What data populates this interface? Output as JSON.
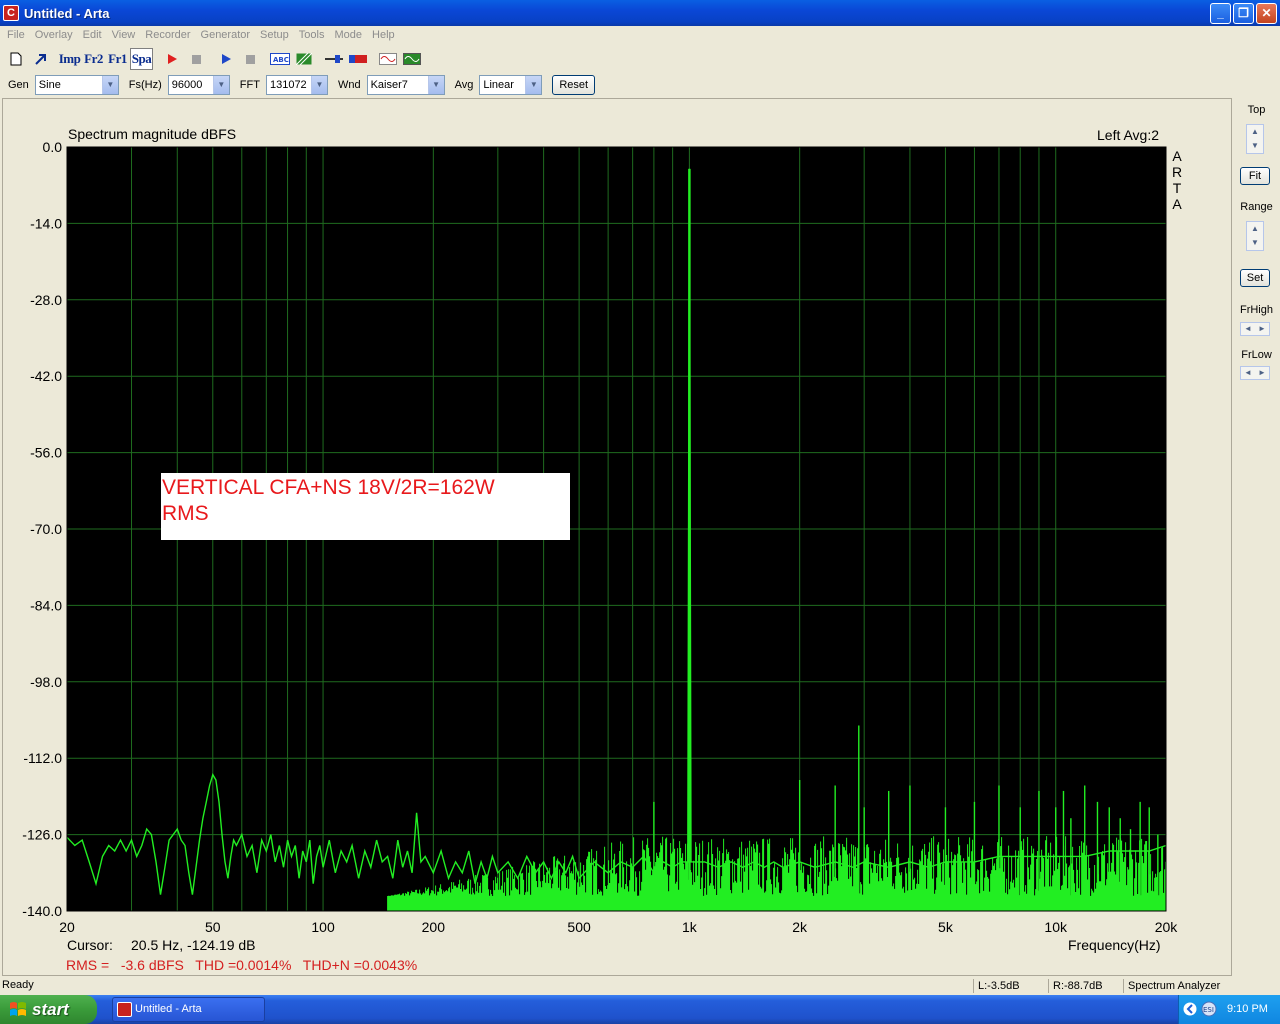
{
  "window": {
    "title": "Untitled - Arta",
    "app_icon_letter": "C",
    "min": "0",
    "max": "1",
    "close": "r"
  },
  "menu": [
    "File",
    "Overlay",
    "Edit",
    "View",
    "Recorder",
    "Generator",
    "Setup",
    "Tools",
    "Mode",
    "Help"
  ],
  "toolbar": {
    "imp": "Imp",
    "fr2": "Fr2",
    "fr1": "Fr1",
    "spa": "Spa"
  },
  "settings": {
    "gen_label": "Gen",
    "gen_value": "Sine",
    "fs_label": "Fs(Hz)",
    "fs_value": "96000",
    "fft_label": "FFT",
    "fft_value": "131072",
    "wnd_label": "Wnd",
    "wnd_value": "Kaiser7",
    "avg_label": "Avg",
    "avg_value": "Linear",
    "reset_label": "Reset"
  },
  "plot": {
    "title": "Spectrum magnitude dBFS",
    "channel_info": "Left  Avg:2",
    "brand": [
      "A",
      "R",
      "T",
      "A"
    ],
    "annotation_line1": "VERTICAL CFA+NS 18V/2R=162W",
    "annotation_line2": "RMS",
    "cursor_label": "Cursor:",
    "cursor_value": "20.5 Hz, -124.19 dB",
    "freq_axis_label": "Frequency(Hz)",
    "rms_text": "RMS =   -3.6 dBFS   THD =0.0014%   THD+N =0.0043%",
    "colors": {
      "background": "#000000",
      "grid": "#1f6b1f",
      "trace": "#22ee22",
      "annotation_text": "#e8191c",
      "rms_text": "#d42020"
    }
  },
  "chart_data": {
    "type": "line",
    "title": "Spectrum magnitude dBFS",
    "xlabel": "Frequency(Hz)",
    "ylabel": "",
    "x_scale": "log",
    "xlim": [
      20,
      20000
    ],
    "ylim": [
      -140,
      0
    ],
    "y_ticks": [
      "0.0",
      "-14.0",
      "-28.0",
      "-42.0",
      "-56.0",
      "-70.0",
      "-84.0",
      "-98.0",
      "-112.0",
      "-126.0",
      "-140.0"
    ],
    "x_ticks": [
      {
        "value": 20,
        "label": "20"
      },
      {
        "value": 50,
        "label": "50"
      },
      {
        "value": 100,
        "label": "100"
      },
      {
        "value": 200,
        "label": "200"
      },
      {
        "value": 500,
        "label": "500"
      },
      {
        "value": 1000,
        "label": "1k"
      },
      {
        "value": 2000,
        "label": "2k"
      },
      {
        "value": 5000,
        "label": "5k"
      },
      {
        "value": 10000,
        "label": "10k"
      },
      {
        "value": 20000,
        "label": "20k"
      }
    ],
    "grid": true,
    "series": [
      {
        "values": [
          [
            20,
            -126.5
          ],
          [
            21,
            -128
          ],
          [
            22,
            -127
          ],
          [
            23,
            -131
          ],
          [
            24,
            -135
          ],
          [
            25,
            -130
          ],
          [
            26,
            -128
          ],
          [
            27,
            -129
          ],
          [
            28,
            -127
          ],
          [
            29,
            -129
          ],
          [
            30,
            -127
          ],
          [
            31,
            -130
          ],
          [
            32,
            -128
          ],
          [
            33,
            -125
          ],
          [
            34,
            -126
          ],
          [
            35,
            -131
          ],
          [
            36,
            -137
          ],
          [
            37,
            -132
          ],
          [
            38,
            -127
          ],
          [
            39,
            -126
          ],
          [
            40,
            -125
          ],
          [
            41,
            -127
          ],
          [
            42,
            -128
          ],
          [
            43,
            -133
          ],
          [
            44,
            -137
          ],
          [
            45,
            -132
          ],
          [
            46,
            -127
          ],
          [
            47,
            -123
          ],
          [
            48,
            -120
          ],
          [
            49,
            -117
          ],
          [
            50,
            -115
          ],
          [
            51,
            -116
          ],
          [
            52,
            -120
          ],
          [
            53,
            -126
          ],
          [
            54,
            -131
          ],
          [
            55,
            -134
          ],
          [
            56,
            -130
          ],
          [
            57,
            -127
          ],
          [
            58,
            -128
          ],
          [
            60,
            -126
          ],
          [
            62,
            -130
          ],
          [
            64,
            -128
          ],
          [
            66,
            -133
          ],
          [
            68,
            -127
          ],
          [
            70,
            -129
          ],
          [
            72,
            -126
          ],
          [
            74,
            -131
          ],
          [
            76,
            -128
          ],
          [
            78,
            -132
          ],
          [
            80,
            -127
          ],
          [
            82,
            -130
          ],
          [
            84,
            -128
          ],
          [
            86,
            -134
          ],
          [
            88,
            -129
          ],
          [
            90,
            -131
          ],
          [
            92,
            -127
          ],
          [
            94,
            -135
          ],
          [
            96,
            -130
          ],
          [
            98,
            -128
          ],
          [
            100,
            -132
          ],
          [
            104,
            -127
          ],
          [
            108,
            -133
          ],
          [
            112,
            -129
          ],
          [
            116,
            -131
          ],
          [
            120,
            -128
          ],
          [
            125,
            -134
          ],
          [
            130,
            -129
          ],
          [
            135,
            -132
          ],
          [
            140,
            -127
          ],
          [
            145,
            -131
          ],
          [
            150,
            -130
          ],
          [
            155,
            -134
          ],
          [
            160,
            -127
          ],
          [
            165,
            -132
          ],
          [
            170,
            -129
          ],
          [
            175,
            -133
          ],
          [
            180,
            -122
          ],
          [
            185,
            -131
          ],
          [
            190,
            -130
          ],
          [
            200,
            -133
          ],
          [
            210,
            -129
          ],
          [
            220,
            -134
          ],
          [
            230,
            -131
          ],
          [
            240,
            -133
          ],
          [
            250,
            -129
          ],
          [
            260,
            -135
          ],
          [
            270,
            -131
          ],
          [
            280,
            -134
          ],
          [
            290,
            -130
          ],
          [
            300,
            -133
          ],
          [
            320,
            -131
          ],
          [
            340,
            -134
          ],
          [
            360,
            -130
          ],
          [
            380,
            -133
          ],
          [
            400,
            -131
          ],
          [
            420,
            -134
          ],
          [
            440,
            -131
          ],
          [
            460,
            -133
          ],
          [
            480,
            -130
          ],
          [
            500,
            -134
          ],
          [
            550,
            -131
          ],
          [
            600,
            -133
          ],
          [
            650,
            -131
          ],
          [
            700,
            -132
          ],
          [
            750,
            -130
          ],
          [
            800,
            -133
          ],
          [
            850,
            -131
          ],
          [
            900,
            -132
          ],
          [
            950,
            -131
          ],
          [
            990,
            -131
          ],
          [
            1000,
            -4
          ],
          [
            1010,
            -131
          ],
          [
            1100,
            -131
          ],
          [
            1200,
            -132
          ],
          [
            1300,
            -131
          ],
          [
            1400,
            -132
          ],
          [
            1500,
            -131
          ],
          [
            1600,
            -132
          ],
          [
            1700,
            -131
          ],
          [
            1800,
            -132
          ],
          [
            2000,
            -131
          ],
          [
            2200,
            -132
          ],
          [
            2500,
            -131
          ],
          [
            2800,
            -132
          ],
          [
            3000,
            -131
          ],
          [
            3500,
            -132
          ],
          [
            4000,
            -131
          ],
          [
            4500,
            -132
          ],
          [
            5000,
            -131
          ],
          [
            6000,
            -131
          ],
          [
            7000,
            -130
          ],
          [
            8000,
            -130
          ],
          [
            9000,
            -130
          ],
          [
            10000,
            -130
          ],
          [
            12000,
            -130
          ],
          [
            14000,
            -129
          ],
          [
            16000,
            -129
          ],
          [
            18000,
            -129
          ],
          [
            20000,
            -128
          ]
        ]
      }
    ],
    "peaks": [
      [
        800,
        -120
      ],
      [
        1000,
        -4
      ],
      [
        2000,
        -116
      ],
      [
        2500,
        -117
      ],
      [
        3000,
        -121
      ],
      [
        3500,
        -118
      ],
      [
        4000,
        -117
      ],
      [
        5000,
        -121
      ],
      [
        6000,
        -120
      ],
      [
        7000,
        -117
      ],
      [
        8000,
        -121
      ],
      [
        9000,
        -118
      ],
      [
        10000,
        -121
      ],
      [
        11000,
        -123
      ],
      [
        12000,
        -117
      ],
      [
        13000,
        -120
      ],
      [
        14000,
        -121
      ],
      [
        15000,
        -123
      ],
      [
        16000,
        -125
      ],
      [
        17000,
        -120
      ],
      [
        18000,
        -121
      ],
      [
        19000,
        -126
      ],
      [
        2900,
        -106
      ],
      [
        10500,
        -118
      ]
    ]
  },
  "side": {
    "top_label": "Top",
    "fit_label": "Fit",
    "range_label": "Range",
    "set_label": "Set",
    "frhigh_label": "FrHigh",
    "frlow_label": "FrLow"
  },
  "status": {
    "ready": "Ready",
    "left_level": "L:-3.5dB",
    "right_level": "R:-88.7dB",
    "mode": "Spectrum Analyzer"
  },
  "taskbar": {
    "start": "start",
    "task_title": "Untitled - Arta",
    "clock": "9:10 PM"
  }
}
